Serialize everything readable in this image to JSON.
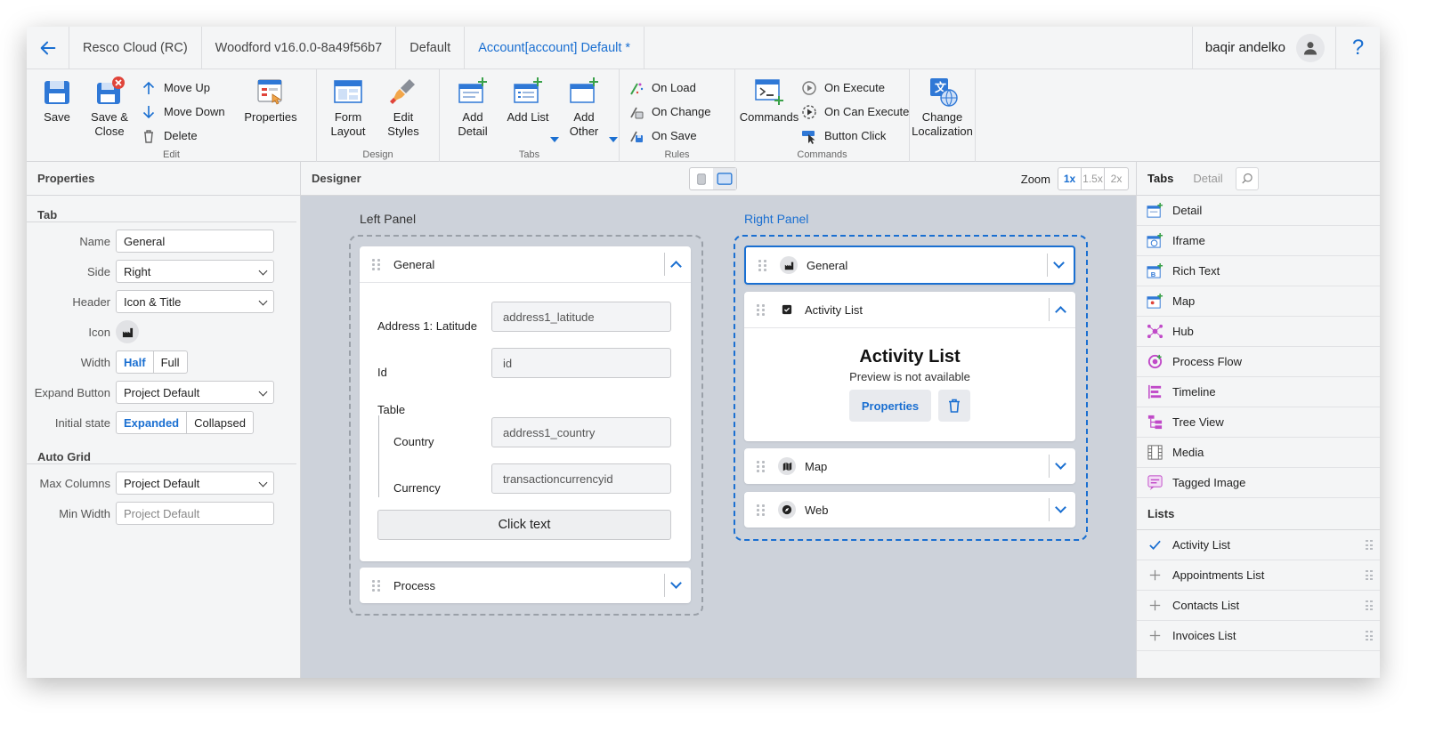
{
  "breadcrumbs": [
    "Resco Cloud (RC)",
    "Woodford v16.0.0-8a49f56b7",
    "Default",
    "Account[account] Default *"
  ],
  "user": {
    "name": "baqir andelko"
  },
  "help_symbol": "?",
  "ribbon": {
    "edit": {
      "label": "Edit",
      "save": "Save",
      "save_close_1": "Save &",
      "save_close_2": "Close",
      "move_up": "Move Up",
      "move_down": "Move Down",
      "delete": "Delete",
      "properties": "Properties"
    },
    "design": {
      "label": "Design",
      "form_layout_1": "Form",
      "form_layout_2": "Layout",
      "edit_styles": "Edit Styles"
    },
    "tabs": {
      "label": "Tabs",
      "add_detail": "Add Detail",
      "add_list": "Add List",
      "add_other": "Add Other"
    },
    "rules": {
      "label": "Rules",
      "on_load": "On Load",
      "on_change": "On Change",
      "on_save": "On Save"
    },
    "commands": {
      "label": "Commands",
      "commands": "Commands",
      "on_execute": "On Execute",
      "on_can_execute": "On Can Execute",
      "button_click": "Button Click"
    },
    "localization": {
      "line1": "Change",
      "line2": "Localization"
    }
  },
  "properties": {
    "title": "Properties",
    "tab_section": "Tab",
    "name_label": "Name",
    "name_value": "General",
    "side_label": "Side",
    "side_value": "Right",
    "header_label": "Header",
    "header_value": "Icon & Title",
    "icon_label": "Icon",
    "width_label": "Width",
    "width_half": "Half",
    "width_full": "Full",
    "expand_label": "Expand Button",
    "expand_value": "Project Default",
    "initial_label": "Initial state",
    "initial_expanded": "Expanded",
    "initial_collapsed": "Collapsed",
    "autogrid_section": "Auto Grid",
    "maxcol_label": "Max Columns",
    "maxcol_value": "Project Default",
    "minwidth_label": "Min Width",
    "minwidth_placeholder": "Project Default"
  },
  "designer": {
    "title": "Designer",
    "zoom_label": "Zoom",
    "zoom_options": [
      "1x",
      "1.5x",
      "2x"
    ],
    "zoom_selected": "1x",
    "left_panel": {
      "label": "Left Panel",
      "general": {
        "title": "General",
        "fields": [
          {
            "label": "Address 1: Latitude",
            "value": "address1_latitude"
          },
          {
            "label": "Id",
            "value": "id"
          }
        ],
        "table_label": "Table",
        "table_fields": [
          {
            "label": "Country",
            "value": "address1_country"
          },
          {
            "label": "Currency",
            "value": "transactioncurrencyid"
          }
        ],
        "button": "Click text"
      },
      "process": {
        "title": "Process"
      }
    },
    "right_panel": {
      "label": "Right Panel",
      "general": {
        "title": "General"
      },
      "activity": {
        "title": "Activity List",
        "preview_title": "Activity List",
        "preview_sub": "Preview is not available",
        "properties_btn": "Properties"
      },
      "map": {
        "title": "Map"
      },
      "web": {
        "title": "Web"
      }
    }
  },
  "toolbox": {
    "tabs": [
      "Tabs",
      "Detail"
    ],
    "active_tab": "Tabs",
    "tab_items": [
      "Detail",
      "Iframe",
      "Rich Text",
      "Map",
      "Hub",
      "Process Flow",
      "Timeline",
      "Tree View",
      "Media",
      "Tagged Image"
    ],
    "lists_section": "Lists",
    "list_items": [
      {
        "name": "Activity List",
        "added": true
      },
      {
        "name": "Appointments List",
        "added": false
      },
      {
        "name": "Contacts List",
        "added": false
      },
      {
        "name": "Invoices List",
        "added": false
      }
    ]
  },
  "colors": {
    "accent": "#1a6fd1",
    "canvas": "#cdd2da",
    "panel": "#f4f5f6"
  }
}
